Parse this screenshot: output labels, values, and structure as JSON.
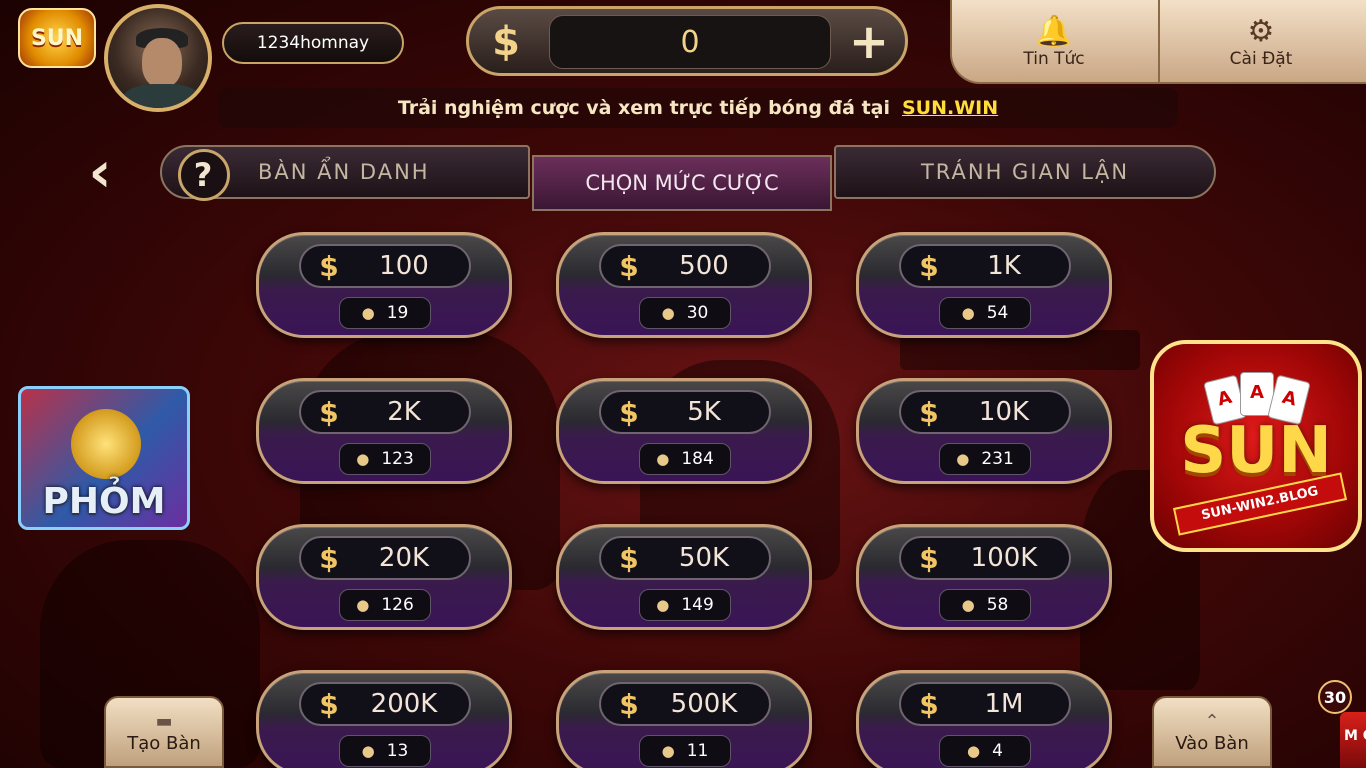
{
  "header": {
    "logo_text": "SUN",
    "username": "1234homnay",
    "balance": "0",
    "currency_symbol": "$",
    "add_symbol": "+",
    "news_label": "Tin Tức",
    "settings_label": "Cài Đặt"
  },
  "marquee": {
    "text": "Trải nghiệm cược và xem trực tiếp bóng đá tại",
    "link": "SUN.WIN"
  },
  "tabs": [
    {
      "label": "BÀN ẨN DANH"
    },
    {
      "label": "CHỌN MỨC CƯỢC"
    },
    {
      "label": "TRÁNH GIAN LẬN"
    }
  ],
  "bets": [
    {
      "amount": "100",
      "players": "19"
    },
    {
      "amount": "500",
      "players": "30"
    },
    {
      "amount": "1K",
      "players": "54"
    },
    {
      "amount": "2K",
      "players": "123"
    },
    {
      "amount": "5K",
      "players": "184"
    },
    {
      "amount": "10K",
      "players": "231"
    },
    {
      "amount": "20K",
      "players": "126"
    },
    {
      "amount": "50K",
      "players": "149"
    },
    {
      "amount": "100K",
      "players": "58"
    },
    {
      "amount": "200K",
      "players": "13"
    },
    {
      "amount": "500K",
      "players": "11"
    },
    {
      "amount": "1M",
      "players": "4"
    }
  ],
  "side": {
    "game_label": "PHỎM",
    "brand": "SUN",
    "brand_ribbon": "SUN-WIN2.BLOG",
    "create_label": "Tạo Bàn",
    "join_label": "Vào Bàn",
    "notif_count": "30",
    "corner_text": "M GA"
  },
  "icons": {
    "back": "chevron-left-icon",
    "help": "question-icon",
    "news": "bell-icon",
    "settings": "gear-icon",
    "user": "user-icon"
  }
}
